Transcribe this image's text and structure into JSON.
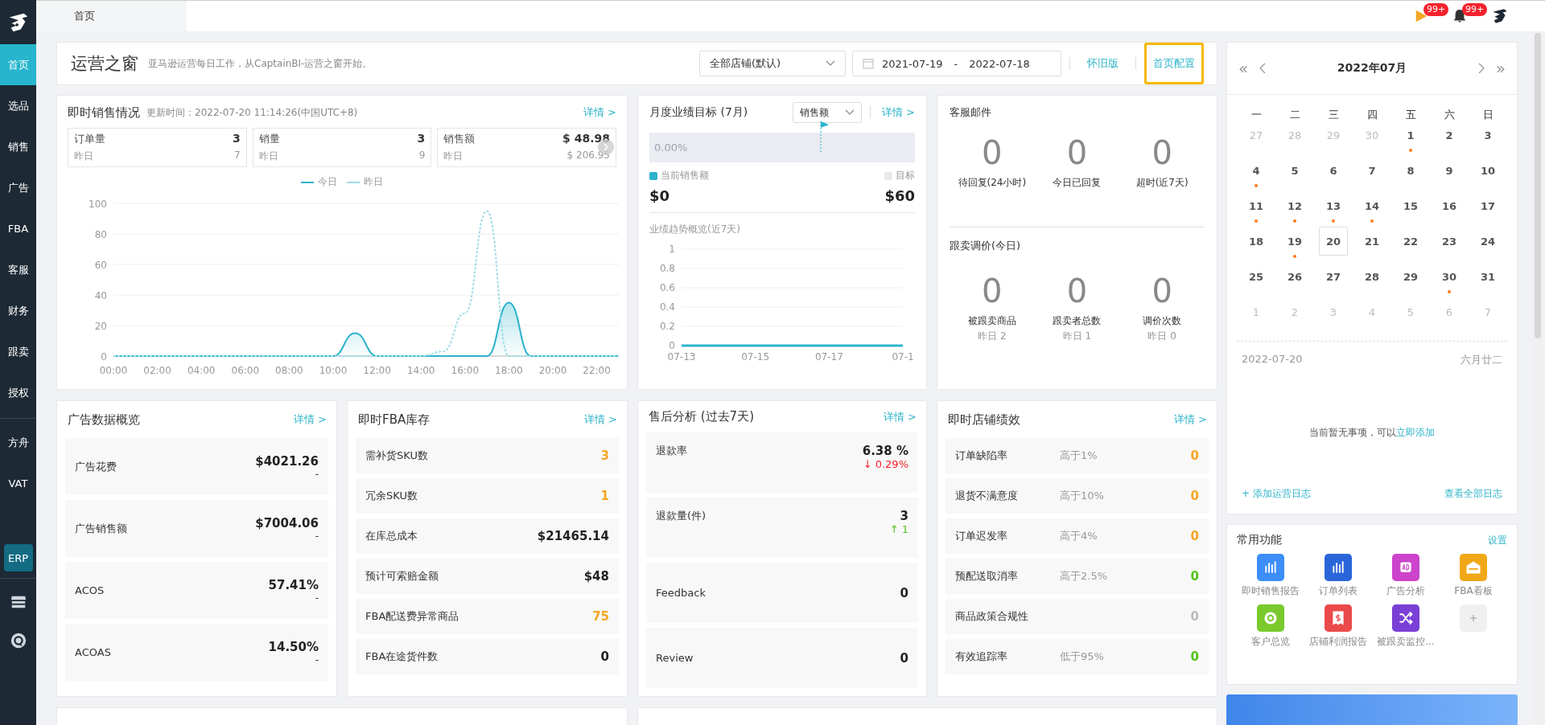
{
  "topbar": {
    "tab": {
      "label": "首页",
      "selected": true
    },
    "notifications": [
      {
        "kind": "flag",
        "badge": "99+"
      },
      {
        "kind": "bell",
        "badge": "99+"
      }
    ]
  },
  "sidebar": {
    "items": [
      {
        "label": "首页",
        "selected": true
      },
      {
        "label": "选品",
        "selected": false
      },
      {
        "label": "销售",
        "selected": false
      },
      {
        "label": "广告",
        "selected": false
      },
      {
        "label": "FBA",
        "selected": false
      },
      {
        "label": "客服",
        "selected": false
      },
      {
        "label": "财务",
        "selected": false
      },
      {
        "label": "跟卖",
        "selected": false
      },
      {
        "label": "授权",
        "selected": false
      }
    ],
    "extra_items": [
      {
        "label": "方舟",
        "kind": "link"
      },
      {
        "label": "VAT",
        "kind": "link"
      },
      {
        "label": "ERP",
        "kind": "badge"
      }
    ]
  },
  "header": {
    "title": "运营之窗",
    "subtitle": "亚马逊运营每日工作，从CaptainBI-运营之窗开始。",
    "store_select": "全部店铺(默认)",
    "date_start": "2021-07-19",
    "date_sep": "-",
    "date_end": "2022-07-18",
    "links": [
      {
        "label": "怀旧版",
        "highlighted": false
      },
      {
        "label": "首页配置",
        "highlighted": true
      }
    ]
  },
  "sales": {
    "title": "即时销售情况",
    "updated": "更新时间：2022-07-20 11:14:26(中国UTC+8)",
    "detail": "详情 >",
    "stats": [
      {
        "label": "订单量",
        "value": "3",
        "sub_label": "昨日",
        "sub_value": "7"
      },
      {
        "label": "销量",
        "value": "3",
        "sub_label": "昨日",
        "sub_value": "9"
      },
      {
        "label": "销售额",
        "value": "$ 48.98",
        "sub_label": "昨日",
        "sub_value": "$ 206.95"
      }
    ],
    "chart_data": {
      "type": "line",
      "categories": [
        "00:00",
        null,
        "02:00",
        null,
        "04:00",
        null,
        "06:00",
        null,
        "08:00",
        null,
        "10:00",
        null,
        "12:00",
        null,
        "14:00",
        null,
        "16:00",
        null,
        "18:00",
        null,
        "20:00",
        null,
        "22:00",
        null
      ],
      "grid": true,
      "series": [
        {
          "name": "今日",
          "color": "#2ab3cb",
          "type": "area",
          "line_style": "solid",
          "values": [
            0,
            0,
            0,
            0,
            0,
            0,
            0,
            0,
            0,
            0,
            0,
            15,
            0,
            0,
            0,
            0,
            0,
            0,
            35,
            0,
            0,
            0,
            0,
            0
          ]
        },
        {
          "name": "昨日",
          "color": "#9edbe8",
          "type": "line",
          "line_style": "dashed",
          "values": [
            0,
            0,
            0,
            0,
            0,
            0,
            0,
            0,
            0,
            0,
            0,
            0,
            0,
            0,
            0,
            3,
            28,
            95,
            0,
            0,
            0,
            0,
            0,
            0
          ]
        }
      ],
      "ylim": [
        0,
        100
      ],
      "yticks": [
        0,
        20,
        40,
        60,
        80,
        100
      ]
    }
  },
  "monthly": {
    "title": "月度业绩目标 (7月)",
    "select": "销售额",
    "detail": "详情 >",
    "progress": {
      "level": 0,
      "reading": "0.00%"
    },
    "legend_current": "当前销售额",
    "legend_target": "目标",
    "current": "$0",
    "target": "$60",
    "trend_title": "业绩趋势概览(近7天)",
    "chart_data": {
      "type": "line",
      "categories": [
        "07-13",
        null,
        "07-15",
        null,
        "07-17",
        null,
        "07-1"
      ],
      "grid": true,
      "series": [
        {
          "color": "#2ab3cb",
          "line_style": "solid",
          "values": [
            0,
            0,
            0,
            0,
            0,
            0,
            0
          ]
        }
      ],
      "ylim": [
        0,
        1
      ],
      "yticks": [
        0,
        0.2,
        0.4,
        0.6,
        0.8,
        1
      ]
    }
  },
  "service": {
    "mail_title": "客服邮件",
    "mail_metrics": [
      {
        "value": "0",
        "label": "待回复(24小时)"
      },
      {
        "value": "0",
        "label": "今日已回复"
      },
      {
        "value": "0",
        "label": "超时(近7天)"
      }
    ],
    "follow_title": "跟卖调价(今日)",
    "follow_metrics": [
      {
        "value": "0",
        "label": "被跟卖商品",
        "sub": "昨日 2"
      },
      {
        "value": "0",
        "label": "跟卖者总数",
        "sub": "昨日 1"
      },
      {
        "value": "0",
        "label": "调价次数",
        "sub": "昨日 0"
      }
    ]
  },
  "ads": {
    "title": "广告数据概览",
    "detail": "详情 >",
    "rows": [
      {
        "label": "广告花费",
        "value": "$4021.26",
        "sub": "-"
      },
      {
        "label": "广告销售额",
        "value": "$7004.06",
        "sub": "-"
      },
      {
        "label": "ACOS",
        "value": "57.41%",
        "sub": "-"
      },
      {
        "label": "ACOAS",
        "value": "14.50%",
        "sub": "-"
      }
    ]
  },
  "fba": {
    "title": "即时FBA库存",
    "detail": "详情 >",
    "rows": [
      {
        "label": "需补货SKU数",
        "value": "3",
        "highlight": true
      },
      {
        "label": "冗余SKU数",
        "value": "1",
        "highlight": true
      },
      {
        "label": "在库总成本",
        "value": "$21465.14",
        "highlight": false
      },
      {
        "label": "预计可索赔金额",
        "value": "$48",
        "highlight": false
      },
      {
        "label": "FBA配送费异常商品",
        "value": "75",
        "highlight": true
      },
      {
        "label": "FBA在途货件数",
        "value": "0",
        "highlight": false
      }
    ]
  },
  "aftersale": {
    "title": "售后分析 (过去7天)",
    "detail": "详情 >",
    "rows": [
      {
        "label": "退款率",
        "value": "6.38 %",
        "change": "↓ 0.29%",
        "color": "#f5222d"
      },
      {
        "label": "退款量(件)",
        "value": "3",
        "change": "↑ 1",
        "color": "#52c41a"
      },
      {
        "label": "Feedback",
        "value": "0"
      },
      {
        "label": "Review",
        "value": "0"
      }
    ]
  },
  "store": {
    "title": "即时店铺绩效",
    "detail": "详情 >",
    "rows": [
      {
        "label": "订单缺陷率",
        "threshold": "高于1%",
        "value": "0",
        "color": "#f5a623"
      },
      {
        "label": "退货不满意度",
        "threshold": "高于10%",
        "value": "0",
        "color": "#f5a623"
      },
      {
        "label": "订单迟发率",
        "threshold": "高于4%",
        "value": "0",
        "color": "#f5a623"
      },
      {
        "label": "预配送取消率",
        "threshold": "高于2.5%",
        "value": "0",
        "color": "#52c41a"
      },
      {
        "label": "商品政策合规性",
        "value": "0",
        "color": "#bbbbbb"
      },
      {
        "label": "有效追踪率",
        "threshold": "低于95%",
        "value": "0",
        "color": "#52c41a"
      }
    ]
  },
  "calendar": {
    "prev_year": "«",
    "next_year": "»",
    "title": "2022年07月",
    "weekdays": [
      "一",
      "二",
      "三",
      "四",
      "五",
      "六",
      "日"
    ],
    "weeks": [
      [
        {
          "day": "27",
          "other": true,
          "event": false,
          "selected": false
        },
        {
          "day": "28",
          "other": true,
          "event": false,
          "selected": false
        },
        {
          "day": "29",
          "other": true,
          "event": false,
          "selected": false
        },
        {
          "day": "30",
          "other": true,
          "event": false,
          "selected": false
        },
        {
          "day": "1",
          "other": false,
          "event": true,
          "selected": false
        },
        {
          "day": "2",
          "other": false,
          "event": false,
          "selected": false
        },
        {
          "day": "3",
          "other": false,
          "event": false,
          "selected": false
        }
      ],
      [
        {
          "day": "4",
          "other": false,
          "event": true,
          "selected": false
        },
        {
          "day": "5",
          "other": false,
          "event": false,
          "selected": false
        },
        {
          "day": "6",
          "other": false,
          "event": false,
          "selected": false
        },
        {
          "day": "7",
          "other": false,
          "event": false,
          "selected": false
        },
        {
          "day": "8",
          "other": false,
          "event": false,
          "selected": false
        },
        {
          "day": "9",
          "other": false,
          "event": false,
          "selected": false
        },
        {
          "day": "10",
          "other": false,
          "event": false,
          "selected": false
        }
      ],
      [
        {
          "day": "11",
          "other": false,
          "event": true,
          "selected": false
        },
        {
          "day": "12",
          "other": false,
          "event": true,
          "selected": false
        },
        {
          "day": "13",
          "other": false,
          "event": true,
          "selected": false
        },
        {
          "day": "14",
          "other": false,
          "event": true,
          "selected": false
        },
        {
          "day": "15",
          "other": false,
          "event": false,
          "selected": false
        },
        {
          "day": "16",
          "other": false,
          "event": false,
          "selected": false
        },
        {
          "day": "17",
          "other": false,
          "event": false,
          "selected": false
        }
      ],
      [
        {
          "day": "18",
          "other": false,
          "event": false,
          "selected": false
        },
        {
          "day": "19",
          "other": false,
          "event": true,
          "selected": false
        },
        {
          "day": "20",
          "other": false,
          "event": false,
          "selected": true
        },
        {
          "day": "21",
          "other": false,
          "event": false,
          "selected": false
        },
        {
          "day": "22",
          "other": false,
          "event": false,
          "selected": false
        },
        {
          "day": "23",
          "other": false,
          "event": false,
          "selected": false
        },
        {
          "day": "24",
          "other": false,
          "event": false,
          "selected": false
        }
      ],
      [
        {
          "day": "25",
          "other": false,
          "event": false,
          "selected": false
        },
        {
          "day": "26",
          "other": false,
          "event": false,
          "selected": false
        },
        {
          "day": "27",
          "other": false,
          "event": false,
          "selected": false
        },
        {
          "day": "28",
          "other": false,
          "event": false,
          "selected": false
        },
        {
          "day": "29",
          "other": false,
          "event": false,
          "selected": false
        },
        {
          "day": "30",
          "other": false,
          "event": true,
          "selected": false
        },
        {
          "day": "31",
          "other": false,
          "event": false,
          "selected": false
        }
      ],
      [
        {
          "day": "1",
          "other": true,
          "event": false,
          "selected": false
        },
        {
          "day": "2",
          "other": true,
          "event": false,
          "selected": false
        },
        {
          "day": "3",
          "other": true,
          "event": false,
          "selected": false
        },
        {
          "day": "4",
          "other": true,
          "event": false,
          "selected": false
        },
        {
          "day": "5",
          "other": true,
          "event": false,
          "selected": false
        },
        {
          "day": "6",
          "other": true,
          "event": false,
          "selected": false
        },
        {
          "day": "7",
          "other": true,
          "event": false,
          "selected": false
        }
      ]
    ],
    "date": "2022-07-20",
    "lunar": "六月廿二",
    "empty_text": "当前暂无事项，可以",
    "empty_link": "立即添加",
    "add_log": "+ 添加运营日志",
    "all_logs": "查看全部日志"
  },
  "shortcuts": {
    "title": "常用功能",
    "settings": "设置",
    "items": [
      {
        "label": "即时销售报告",
        "kind": "bars",
        "color": "#3d8ef8"
      },
      {
        "label": "订单列表",
        "kind": "bars",
        "color": "#2b66d9"
      },
      {
        "label": "广告分析",
        "kind": "ad",
        "color": "#cc44cc"
      },
      {
        "label": "FBA看板",
        "kind": "box",
        "color": "#f0a818"
      },
      {
        "label": "客户总览",
        "kind": "chat",
        "color": "#7ac92d"
      },
      {
        "label": "店铺利润报告",
        "kind": "receipt",
        "color": "#eb4a4a"
      },
      {
        "label": "被跟卖监控...",
        "kind": "shuffle",
        "color": "#7a3fd6"
      },
      {
        "kind": "add"
      }
    ]
  }
}
